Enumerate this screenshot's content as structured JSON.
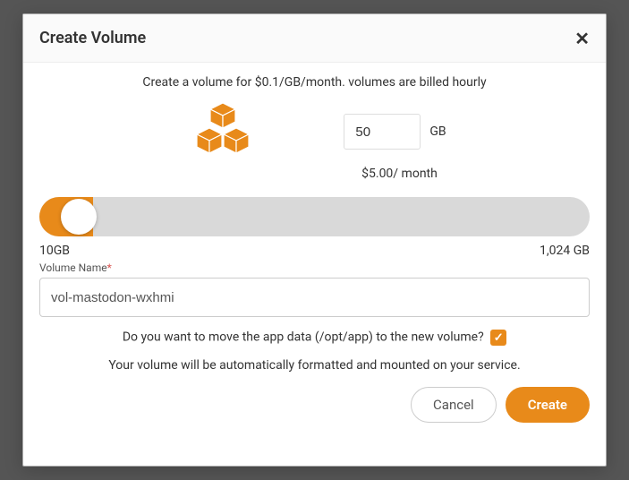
{
  "modal": {
    "title": "Create Volume",
    "intro": "Create a volume for $0.1/GB/month. volumes are billed hourly",
    "icon_name": "volume-cubes-icon",
    "size_value": "50",
    "size_unit": "GB",
    "price_text": "$5.00/ month",
    "slider_min_label": "10GB",
    "slider_max_label": "1,024 GB",
    "name_label": "Volume Name",
    "name_value": "vol-mastodon-wxhmi",
    "move_prompt": "Do you want to move the app data (/opt/app) to the new volume?",
    "move_checked": true,
    "info_text": "Your volume will be automatically formatted and mounted on your service.",
    "cancel_label": "Cancel",
    "create_label": "Create"
  },
  "colors": {
    "accent": "#e88a1a"
  }
}
